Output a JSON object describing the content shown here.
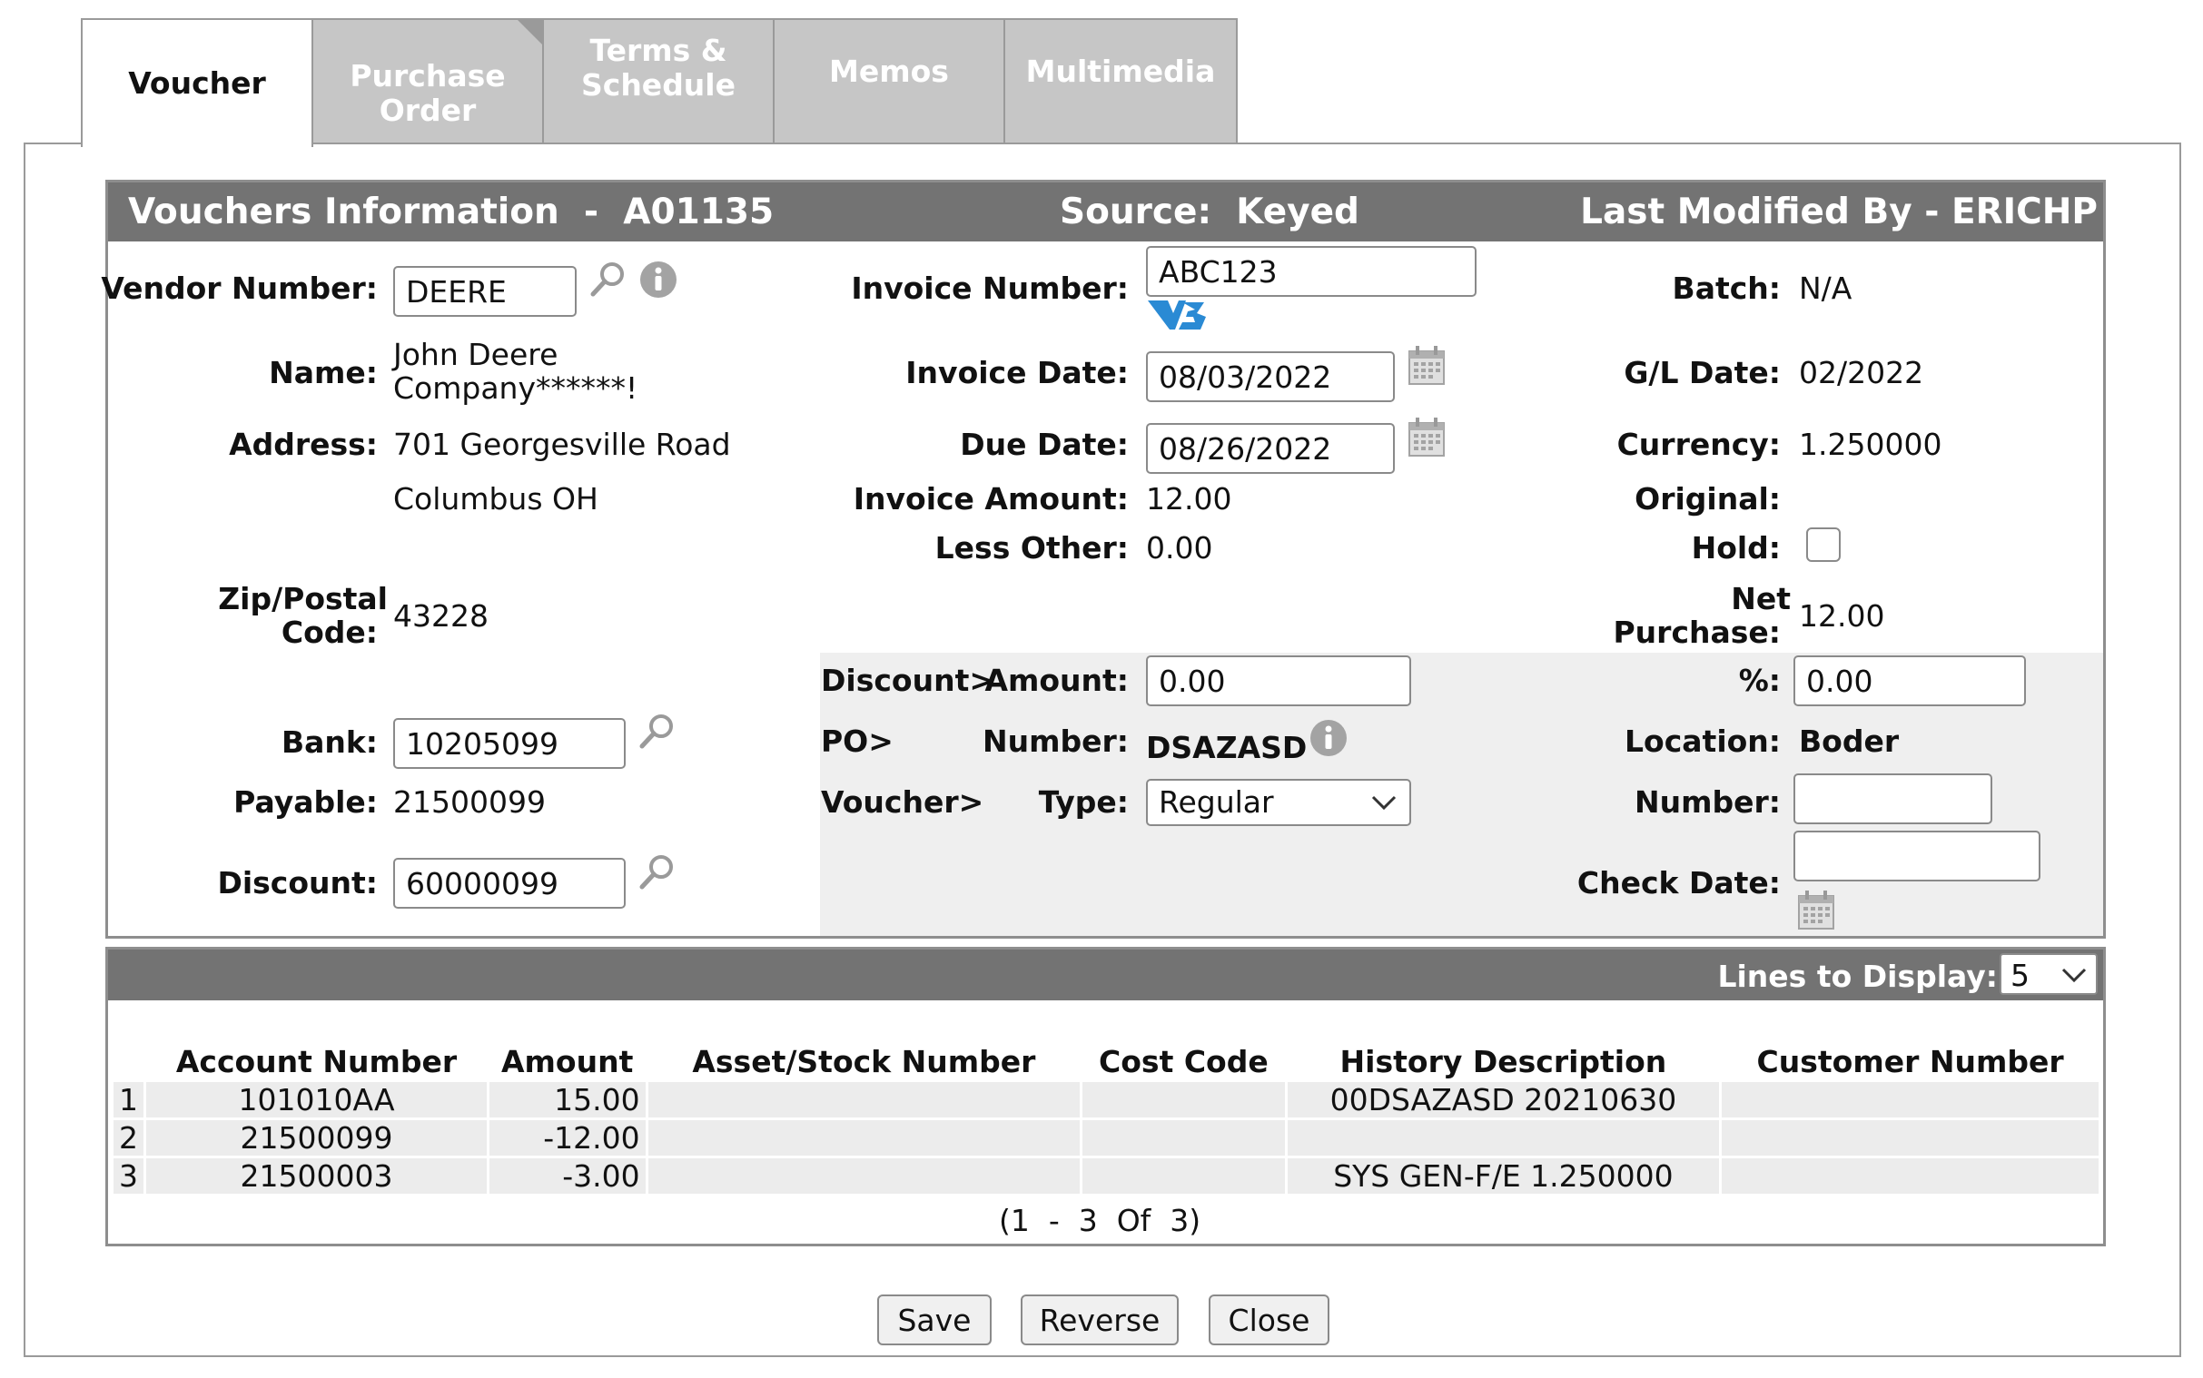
{
  "tabs": [
    {
      "label": "Voucher"
    },
    {
      "label": "Purchase Order"
    },
    {
      "label": "Terms & Schedule"
    },
    {
      "label": "Memos"
    },
    {
      "label": "Multimedia"
    }
  ],
  "header": {
    "title": "Vouchers Information  -  A01135",
    "source": "Source:  Keyed",
    "modified": "Last Modified By - ERICHP"
  },
  "left": {
    "vendor_label": "Vendor Number:",
    "vendor_value": "DEERE",
    "name_label": "Name:",
    "name_line1": "John Deere",
    "name_line2": "Company******!",
    "address_label": "Address:",
    "address_line1": "701 Georgesville Road",
    "address_line2": "Columbus OH",
    "zip_label_1": "Zip/Postal",
    "zip_label_2": "Code:",
    "zip_value": "43228",
    "bank_label": "Bank:",
    "bank_value": "10205099",
    "payable_label": "Payable:",
    "payable_value": "21500099",
    "discount_label": "Discount:",
    "discount_value": "60000099"
  },
  "middle": {
    "invoice_number_label": "Invoice Number:",
    "invoice_number_value": "ABC123",
    "invoice_date_label": "Invoice Date:",
    "invoice_date_value": "08/03/2022",
    "due_date_label": "Due Date:",
    "due_date_value": "08/26/2022",
    "invoice_amount_label": "Invoice Amount:",
    "invoice_amount_value": "12.00",
    "less_other_label": "Less Other:",
    "less_other_value": "0.00",
    "discount_prefix": "Discount>",
    "discount_amount_label": "Amount:",
    "discount_amount_value": "0.00",
    "po_prefix": "PO>",
    "po_number_label": "Number:",
    "po_number_value": "DSAZASD",
    "voucher_prefix": "Voucher>",
    "voucher_type_label": "Type:",
    "voucher_type_value": "Regular"
  },
  "right": {
    "batch_label": "Batch:",
    "batch_value": "N/A",
    "gl_date_label": "G/L Date:",
    "gl_date_value": "02/2022",
    "currency_label": "Currency:",
    "currency_value": "1.250000",
    "original_label": "Original:",
    "hold_label": "Hold:",
    "hold_checked": false,
    "net_label_1": "Net",
    "net_label_2": "Purchase:",
    "net_value": "12.00",
    "pct_label": "%:",
    "pct_value": "0.00",
    "location_label": "Location:",
    "location_value": "Boder",
    "number_label": "Number:",
    "number_value": "",
    "check_date_label": "Check Date:",
    "check_date_value": ""
  },
  "lines": {
    "lines_to_display_label": "Lines to Display:",
    "lines_to_display_value": "5",
    "columns": [
      "Account Number",
      "Amount",
      "Asset/Stock Number",
      "Cost Code",
      "History Description",
      "Customer Number"
    ],
    "rows": [
      {
        "n": "1",
        "account": "101010AA",
        "amount": "15.00",
        "asset": "",
        "cost": "",
        "history": "00DSAZASD 20210630",
        "customer": ""
      },
      {
        "n": "2",
        "account": "21500099",
        "amount": "-12.00",
        "asset": "",
        "cost": "",
        "history": "",
        "customer": ""
      },
      {
        "n": "3",
        "account": "21500003",
        "amount": "-3.00",
        "asset": "",
        "cost": "",
        "history": "SYS GEN-F/E 1.250000",
        "customer": ""
      }
    ],
    "pager": "(1  -  3  Of  3)"
  },
  "buttons": {
    "save": "Save",
    "reverse": "Reverse",
    "close": "Close"
  }
}
